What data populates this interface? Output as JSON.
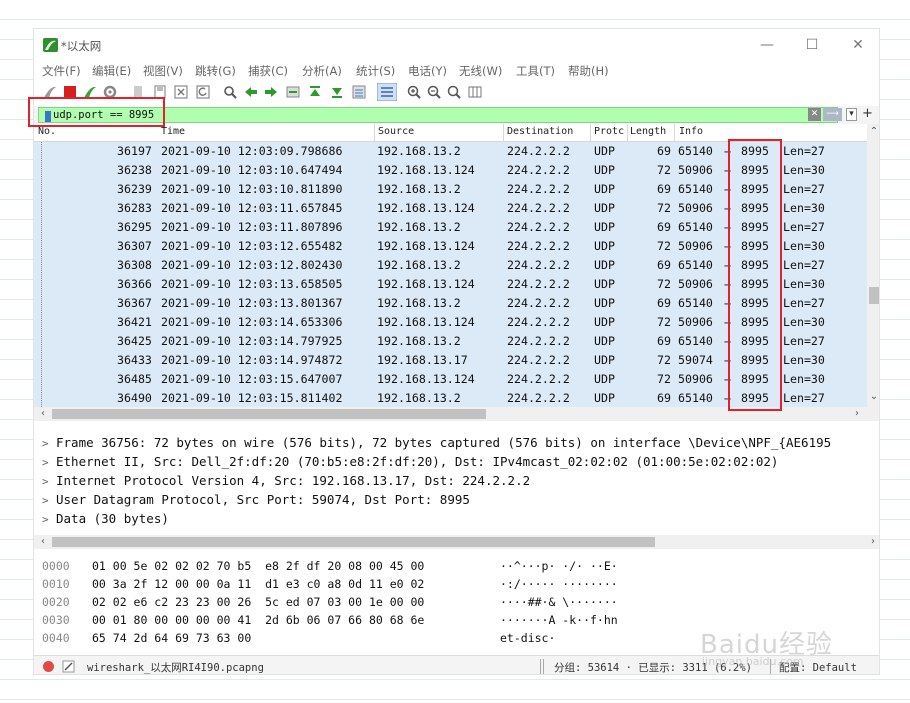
{
  "window": {
    "title": "*以太网",
    "minimize": "—",
    "maximize": "☐",
    "close": "✕"
  },
  "menu": [
    "文件(F)",
    "编辑(E)",
    "视图(V)",
    "跳转(G)",
    "捕获(C)",
    "分析(A)",
    "统计(S)",
    "电话(Y)",
    "无线(W)",
    "工具(T)",
    "帮助(H)"
  ],
  "toolbar_icons": [
    "shark-fin-icon",
    "stop-icon",
    "restart-icon",
    "options-gear-icon",
    "open-file-icon",
    "save-icon",
    "close-file-icon",
    "reload-icon",
    "find-icon",
    "back-icon",
    "forward-icon",
    "goto-icon",
    "first-icon",
    "last-icon",
    "autoscroll-icon",
    "colorize-icon",
    "zoom-in-icon",
    "zoom-out-icon",
    "zoom-reset-icon",
    "resize-columns-icon"
  ],
  "filter": {
    "value": "udp.port == 8995",
    "clear": "✕",
    "apply": "⟶",
    "dropdown": "▾",
    "add": "+"
  },
  "columns": [
    "No.",
    "Time",
    "Source",
    "Destination",
    "Protc",
    "Length",
    "Info"
  ],
  "packets": [
    {
      "no": "36197",
      "time": "2021-09-10 12:03:09.798686",
      "src": "192.168.13.2",
      "dst": "224.2.2.2",
      "proto": "UDP",
      "len": "69",
      "sport": "65140",
      "dport": "8995",
      "info": "Len=27"
    },
    {
      "no": "36238",
      "time": "2021-09-10 12:03:10.647494",
      "src": "192.168.13.124",
      "dst": "224.2.2.2",
      "proto": "UDP",
      "len": "72",
      "sport": "50906",
      "dport": "8995",
      "info": "Len=30"
    },
    {
      "no": "36239",
      "time": "2021-09-10 12:03:10.811890",
      "src": "192.168.13.2",
      "dst": "224.2.2.2",
      "proto": "UDP",
      "len": "69",
      "sport": "65140",
      "dport": "8995",
      "info": "Len=27"
    },
    {
      "no": "36283",
      "time": "2021-09-10 12:03:11.657845",
      "src": "192.168.13.124",
      "dst": "224.2.2.2",
      "proto": "UDP",
      "len": "72",
      "sport": "50906",
      "dport": "8995",
      "info": "Len=30"
    },
    {
      "no": "36295",
      "time": "2021-09-10 12:03:11.807896",
      "src": "192.168.13.2",
      "dst": "224.2.2.2",
      "proto": "UDP",
      "len": "69",
      "sport": "65140",
      "dport": "8995",
      "info": "Len=27"
    },
    {
      "no": "36307",
      "time": "2021-09-10 12:03:12.655482",
      "src": "192.168.13.124",
      "dst": "224.2.2.2",
      "proto": "UDP",
      "len": "72",
      "sport": "50906",
      "dport": "8995",
      "info": "Len=30"
    },
    {
      "no": "36308",
      "time": "2021-09-10 12:03:12.802430",
      "src": "192.168.13.2",
      "dst": "224.2.2.2",
      "proto": "UDP",
      "len": "69",
      "sport": "65140",
      "dport": "8995",
      "info": "Len=27"
    },
    {
      "no": "36366",
      "time": "2021-09-10 12:03:13.658505",
      "src": "192.168.13.124",
      "dst": "224.2.2.2",
      "proto": "UDP",
      "len": "72",
      "sport": "50906",
      "dport": "8995",
      "info": "Len=30"
    },
    {
      "no": "36367",
      "time": "2021-09-10 12:03:13.801367",
      "src": "192.168.13.2",
      "dst": "224.2.2.2",
      "proto": "UDP",
      "len": "69",
      "sport": "65140",
      "dport": "8995",
      "info": "Len=27"
    },
    {
      "no": "36421",
      "time": "2021-09-10 12:03:14.653306",
      "src": "192.168.13.124",
      "dst": "224.2.2.2",
      "proto": "UDP",
      "len": "72",
      "sport": "50906",
      "dport": "8995",
      "info": "Len=30"
    },
    {
      "no": "36425",
      "time": "2021-09-10 12:03:14.797925",
      "src": "192.168.13.2",
      "dst": "224.2.2.2",
      "proto": "UDP",
      "len": "69",
      "sport": "65140",
      "dport": "8995",
      "info": "Len=27"
    },
    {
      "no": "36433",
      "time": "2021-09-10 12:03:14.974872",
      "src": "192.168.13.17",
      "dst": "224.2.2.2",
      "proto": "UDP",
      "len": "72",
      "sport": "59074",
      "dport": "8995",
      "info": "Len=30"
    },
    {
      "no": "36485",
      "time": "2021-09-10 12:03:15.647007",
      "src": "192.168.13.124",
      "dst": "224.2.2.2",
      "proto": "UDP",
      "len": "72",
      "sport": "50906",
      "dport": "8995",
      "info": "Len=30"
    },
    {
      "no": "36490",
      "time": "2021-09-10 12:03:15.811402",
      "src": "192.168.13.2",
      "dst": "224.2.2.2",
      "proto": "UDP",
      "len": "69",
      "sport": "65140",
      "dport": "8995",
      "info": "Len=27"
    }
  ],
  "arrow": "→",
  "details": [
    "Frame 36756: 72 bytes on wire (576 bits), 72 bytes captured (576 bits) on interface \\Device\\NPF_{AE6195",
    "Ethernet II, Src: Dell_2f:df:20 (70:b5:e8:2f:df:20), Dst: IPv4mcast_02:02:02 (01:00:5e:02:02:02)",
    "Internet Protocol Version 4, Src: 192.168.13.17, Dst: 224.2.2.2",
    "User Datagram Protocol, Src Port: 59074, Dst Port: 8995",
    "Data (30 bytes)"
  ],
  "hex": [
    {
      "offset": "0000",
      "bytes": "01 00 5e 02 02 02 70 b5  e8 2f df 20 08 00 45 00",
      "ascii": "··^···p· ·/· ··E·"
    },
    {
      "offset": "0010",
      "bytes": "00 3a 2f 12 00 00 0a 11  d1 e3 c0 a8 0d 11 e0 02",
      "ascii": "·:/····· ········"
    },
    {
      "offset": "0020",
      "bytes": "02 02 e6 c2 23 23 00 26  5c ed 07 03 00 1e 00 00",
      "ascii": "····##·& \\·······"
    },
    {
      "offset": "0030",
      "bytes": "00 01 80 00 00 00 00 41  2d 6b 06 07 66 80 68 6e",
      "ascii": "·······A -k··f·hn"
    },
    {
      "offset": "0040",
      "bytes": "65 74 2d 64 69 73 63 00",
      "ascii": "et-disc·"
    }
  ],
  "status": {
    "file": "wireshark_以太网RI4I90.pcapng",
    "stats": "分组: 53614 · 已显示: 3311 (6.2%)",
    "profile": "配置: Default"
  },
  "watermark": "Baidu经验",
  "watermark_sub": "jingyan.baidu.com",
  "colors": {
    "filter_bg": "#afffaf",
    "row_bg": "#dce9f7",
    "highlight": "#e0222c"
  }
}
